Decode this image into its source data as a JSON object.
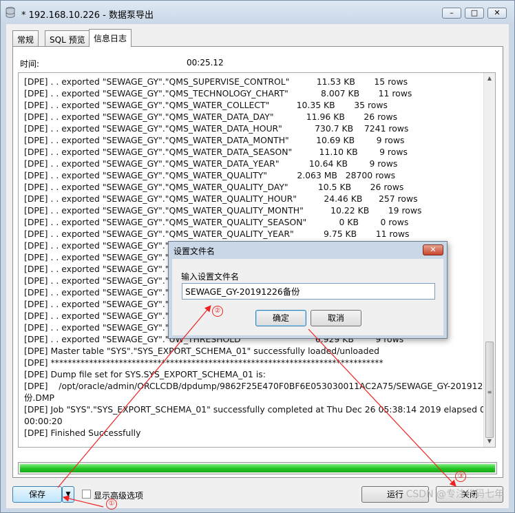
{
  "window": {
    "title": "* 192.168.10.226 - 数据泵导出",
    "minimize": "–",
    "maximize": "□",
    "close": "✕"
  },
  "tabs": [
    {
      "label": "常规"
    },
    {
      "label": "SQL 预览"
    },
    {
      "label": "信息日志"
    }
  ],
  "info": {
    "time_label": "时间:",
    "time_value": "00:25.12"
  },
  "log_lines": [
    "[DPE] . . exported \"SEWAGE_GY\".\"QMS_SUPERVISE_CONTROL\"          11.53 KB       15 rows",
    "[DPE] . . exported \"SEWAGE_GY\".\"QMS_TECHNOLOGY_CHART\"            8.007 KB       11 rows",
    "[DPE] . . exported \"SEWAGE_GY\".\"QMS_WATER_COLLECT\"          10.35 KB       35 rows",
    "[DPE] . . exported \"SEWAGE_GY\".\"QMS_WATER_DATA_DAY\"            11.96 KB       26 rows",
    "[DPE] . . exported \"SEWAGE_GY\".\"QMS_WATER_DATA_HOUR\"            730.7 KB    7241 rows",
    "[DPE] . . exported \"SEWAGE_GY\".\"QMS_WATER_DATA_MONTH\"          10.69 KB        9 rows",
    "[DPE] . . exported \"SEWAGE_GY\".\"QMS_WATER_DATA_SEASON\"          11.10 KB        9 rows",
    "[DPE] . . exported \"SEWAGE_GY\".\"QMS_WATER_DATA_YEAR\"           10.64 KB        9 rows",
    "[DPE] . . exported \"SEWAGE_GY\".\"QMS_WATER_QUALITY\"           2.063 MB   28700 rows",
    "[DPE] . . exported \"SEWAGE_GY\".\"QMS_WATER_QUALITY_DAY\"           10.5 KB       26 rows",
    "[DPE] . . exported \"SEWAGE_GY\".\"QMS_WATER_QUALITY_HOUR\"          24.46 KB      257 rows",
    "[DPE] . . exported \"SEWAGE_GY\".\"QMS_WATER_QUALITY_MONTH\"          10.22 KB       19 rows",
    "[DPE] . . exported \"SEWAGE_GY\".\"QMS_WATER_QUALITY_SEASON\"            0 KB        0 rows",
    "[DPE] . . exported \"SEWAGE_GY\".\"QMS_WATER_QUALITY_YEAR\"           9.75 KB       11 rows",
    "[DPE] . . exported \"SEWAGE_GY\".\"QM",
    "[DPE] . . exported \"SEWAGE_GY\".\"SS",
    "[DPE] . . exported \"SEWAGE_GY\".\"SS",
    "[DPE] . . exported \"SEWAGE_GY\".\"TK",
    "[DPE] . . exported \"SEWAGE_GY\".\"UW",
    "[DPE] . . exported \"SEWAGE_GY\".\"UW",
    "[DPE] . . exported \"SEWAGE_GY\".\"UW",
    "[DPE] . . exported \"SEWAGE_GY\".\"UW",
    "[DPE] . . exported \"SEWAGE_GY\".\"UW_THRESHOLD\"                          6.929 KB        9 rows",
    "[DPE] Master table \"SYS\".\"SYS_EXPORT_SCHEMA_01\" successfully loaded/unloaded",
    "[DPE] ******************************************************************************",
    "[DPE] Dump file set for SYS.SYS_EXPORT_SCHEMA_01 is:",
    "[DPE]    /opt/oracle/admin/ORCLCDB/dpdump/9862F25E470F0BF6E053030011AC2A75/SEWAGE_GY-20191226备",
    "份.DMP",
    "[DPE] Job \"SYS\".\"SYS_EXPORT_SCHEMA_01\" successfully completed at Thu Dec 26 05:38:14 2019 elapsed 0",
    "00:00:20",
    "[DPE] Finished Successfully"
  ],
  "progress": {
    "fraction": 1.0
  },
  "bottom": {
    "save_label": "保存",
    "save_dropdown": "▼",
    "advanced_checkbox_label": "显示高级选项",
    "run_label": "运行",
    "close_label": "关闭"
  },
  "dialog": {
    "title": "设置文件名",
    "close": "✕",
    "prompt_label": "输入设置文件名",
    "input_value": "SEWAGE_GY-20191226备份",
    "ok_label": "确定",
    "cancel_label": "取消"
  },
  "annotations": [
    {
      "label": "①"
    },
    {
      "label": "②"
    },
    {
      "label": "③"
    }
  ],
  "watermark": "CSDN @专注代码七年",
  "colors": {
    "annotation": "#e22222",
    "progress": "#22c322",
    "accent": "#3c7fb1"
  }
}
